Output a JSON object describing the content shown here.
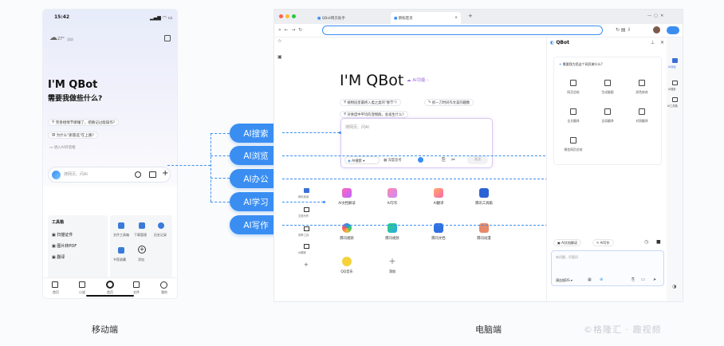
{
  "mobile": {
    "status_time": "15:42",
    "weather_temp": "27°",
    "weather_loc": "深圳",
    "headline": "I'M QBot",
    "subhead": "需要我做些什么?",
    "suggestions": [
      "完善相情节哪懂了，把路记过能操作?",
      "为什么\"斯雷选\"在上路?"
    ],
    "more_link": "进入AI对话框",
    "search_placeholder": "搜网页、问AI",
    "tools_title": "工具箱",
    "tools": [
      "扫描证件",
      "图片转PDF",
      "翻译"
    ],
    "grid": [
      "文件工具箱",
      "下载管理",
      "历史记录",
      "书签收藏",
      "添加"
    ],
    "nav": [
      "首页",
      "小说",
      "首页",
      "文件",
      "我的"
    ]
  },
  "pills": [
    "AI搜索",
    "AI浏览",
    "AI办公",
    "AI学习",
    "AI写作"
  ],
  "browser": {
    "tabs": [
      "QBot网页助手",
      "新标签页"
    ],
    "profile": "QBot",
    "headline": "I'M QBot",
    "badge": "AI功能",
    "suggestions": [
      "植物园里最终入类之类的\"春节\"?",
      "抓一刀时间作文美的趣数",
      "对季度中平均的宠物群，会发生什么?"
    ],
    "input_placeholder": "搜网页、问AI",
    "mode_label": "AI搜索",
    "deep_label": "深度思考",
    "send_label": "发送",
    "left_nav": [
      "网页阅读",
      "文档写作",
      "效率工具",
      "AI翻译",
      "添加"
    ],
    "apps": [
      "AI文档解读",
      "AI写作",
      "AI翻译",
      "腾讯工具箱",
      "腾讯视频",
      "腾讯视频",
      "腾讯文档",
      "腾讯动漫",
      "QQ音乐",
      "添加"
    ],
    "side_question": "需要我为您这个网页做什么?",
    "side_grid": [
      "网页总结",
      "生成脑图",
      "润色修改",
      "全文翻译",
      "全局翻译",
      "对照翻译",
      "微信网页总结"
    ],
    "side_chips": [
      "AI文档解读",
      "AI写作"
    ],
    "side_input": "有问题，尽管问",
    "model_label": "满血版DS",
    "right_rail": [
      "AI对话",
      "AI搜索",
      "AI工具箱"
    ]
  },
  "captions": [
    "移动端",
    "电脑端"
  ],
  "watermark": "©格隆汇 · 趣视频"
}
